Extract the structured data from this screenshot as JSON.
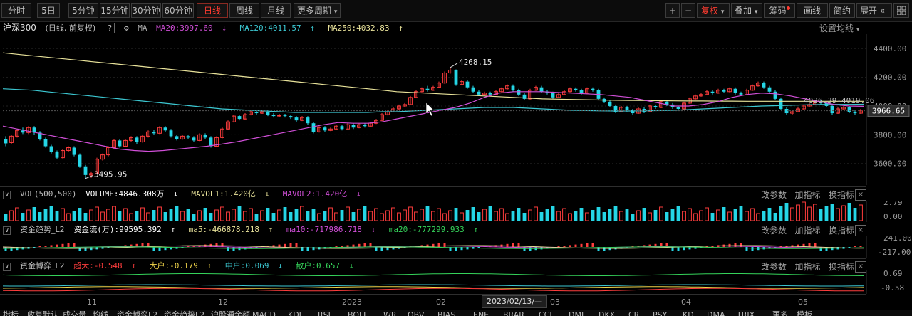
{
  "toolbar": {
    "periods": [
      "分时",
      "5日",
      "5分钟",
      "15分钟",
      "30分钟",
      "60分钟",
      "日线",
      "周线",
      "月线",
      "更多周期"
    ],
    "active_period": "日线",
    "more_arrow": "▾",
    "plus": "+",
    "minus": "−",
    "fuquan": "复权",
    "diejia": "叠加",
    "chouma": "筹码",
    "huaxian": "画线",
    "jianyue": "简约",
    "zhankai": "展开",
    "expand_icon": "«",
    "grid_icon": "grid-icon"
  },
  "main_info": {
    "name": "沪深300",
    "mode": "(日线, 前复权)",
    "help": "?",
    "ma_label": "MA",
    "ma20": "MA20:3997.60",
    "ma20_arrow": "↓",
    "ma120": "MA120:4011.57",
    "ma120_arrow": "↑",
    "ma250": "MA250:4032.83",
    "ma250_arrow": "↑",
    "setting": "设置均线",
    "setting_arrow": "▾",
    "colors": {
      "ma20": "#d14fd8",
      "ma120": "#3cc8d2",
      "ma250": "#e8e29a",
      "up": "#ff3d3d",
      "down": "#25d6e6"
    }
  },
  "vol_info": {
    "label": "VOL(500,500)",
    "volume": "VOLUME:4846.308万",
    "volume_arrow": "↓",
    "mavol1": "MAVOL1:1.420亿",
    "mavol1_arrow": "↓",
    "mavol2": "MAVOL2:1.420亿",
    "mavol2_arrow": "↓",
    "ctl": [
      "改参数",
      "加指标",
      "换指标"
    ],
    "close": "×"
  },
  "flow_info": {
    "label": "资金趋势_L2",
    "zjl": "资金流(万):99595.392",
    "zjl_arrow": "↑",
    "ma5": "ma5:-466878.218",
    "ma5_arrow": "↑",
    "ma10": "ma10:-717986.718",
    "ma10_arrow": "↓",
    "ma20": "ma20:-777299.933",
    "ma20_arrow": "↑",
    "ctl": [
      "改参数",
      "加指标",
      "换指标"
    ],
    "close": "×"
  },
  "game_info": {
    "label": "资金博弈_L2",
    "chaoda": "超大:-0.548",
    "chaoda_arrow": "↑",
    "dahu": "大户:-0.179",
    "dahu_arrow": "↑",
    "zhonghu": "中户:0.069",
    "zhonghu_arrow": "↓",
    "sanhu": "散户:0.657",
    "sanhu_arrow": "↓",
    "ctl": [
      "改参数",
      "加指标",
      "换指标"
    ],
    "close": "×"
  },
  "chart_data": [
    {
      "type": "candlestick",
      "title": "沪深300",
      "y_ticks": [
        "4400.00",
        "4200.00",
        "4000.00",
        "3800.00",
        "3600.00"
      ],
      "ylim": [
        3450,
        4500
      ],
      "current_price": "3966.65",
      "annotations": {
        "high": "4268.15",
        "low": "3495.95",
        "range": "4026.39-4019.06"
      },
      "x_ticks": [
        "11",
        "12",
        "2023",
        "02",
        "03",
        "04",
        "05"
      ],
      "cursor_date": "2023/02/13/—",
      "candles": [
        [
          3770,
          3740,
          3790,
          3720
        ],
        [
          3745,
          3790,
          3800,
          3735
        ],
        [
          3790,
          3830,
          3840,
          3780
        ],
        [
          3830,
          3815,
          3850,
          3805
        ],
        [
          3815,
          3850,
          3860,
          3805
        ],
        [
          3850,
          3815,
          3860,
          3800
        ],
        [
          3815,
          3770,
          3825,
          3760
        ],
        [
          3770,
          3720,
          3780,
          3710
        ],
        [
          3720,
          3680,
          3730,
          3670
        ],
        [
          3680,
          3640,
          3690,
          3630
        ],
        [
          3640,
          3690,
          3700,
          3635
        ],
        [
          3690,
          3710,
          3720,
          3680
        ],
        [
          3710,
          3660,
          3720,
          3650
        ],
        [
          3660,
          3580,
          3670,
          3570
        ],
        [
          3580,
          3520,
          3590,
          3496
        ],
        [
          3520,
          3530,
          3545,
          3500
        ],
        [
          3530,
          3630,
          3640,
          3525
        ],
        [
          3630,
          3660,
          3670,
          3620
        ],
        [
          3660,
          3710,
          3720,
          3650
        ],
        [
          3710,
          3760,
          3770,
          3700
        ],
        [
          3760,
          3720,
          3770,
          3710
        ],
        [
          3720,
          3760,
          3770,
          3715
        ],
        [
          3760,
          3780,
          3790,
          3750
        ],
        [
          3780,
          3750,
          3790,
          3735
        ],
        [
          3750,
          3790,
          3800,
          3745
        ],
        [
          3790,
          3820,
          3830,
          3780
        ],
        [
          3820,
          3810,
          3835,
          3800
        ],
        [
          3810,
          3850,
          3860,
          3805
        ],
        [
          3850,
          3830,
          3860,
          3820
        ],
        [
          3830,
          3790,
          3840,
          3780
        ],
        [
          3790,
          3770,
          3800,
          3760
        ],
        [
          3770,
          3790,
          3800,
          3765
        ],
        [
          3790,
          3780,
          3800,
          3770
        ],
        [
          3780,
          3760,
          3790,
          3750
        ],
        [
          3760,
          3800,
          3810,
          3755
        ],
        [
          3800,
          3780,
          3810,
          3770
        ],
        [
          3780,
          3720,
          3790,
          3710
        ],
        [
          3720,
          3780,
          3790,
          3715
        ],
        [
          3780,
          3840,
          3850,
          3775
        ],
        [
          3840,
          3890,
          3900,
          3835
        ],
        [
          3890,
          3930,
          3940,
          3885
        ],
        [
          3930,
          3910,
          3940,
          3900
        ],
        [
          3910,
          3940,
          3950,
          3905
        ],
        [
          3940,
          3960,
          3970,
          3935
        ],
        [
          3960,
          3950,
          3975,
          3940
        ],
        [
          3950,
          3960,
          3970,
          3945
        ],
        [
          3960,
          3940,
          3970,
          3930
        ],
        [
          3940,
          3930,
          3950,
          3920
        ],
        [
          3930,
          3935,
          3945,
          3925
        ],
        [
          3935,
          3930,
          3945,
          3920
        ],
        [
          3930,
          3920,
          3940,
          3910
        ],
        [
          3920,
          3900,
          3930,
          3890
        ],
        [
          3900,
          3920,
          3930,
          3895
        ],
        [
          3920,
          3880,
          3930,
          3870
        ],
        [
          3880,
          3820,
          3890,
          3810
        ],
        [
          3820,
          3850,
          3860,
          3815
        ],
        [
          3850,
          3830,
          3860,
          3820
        ],
        [
          3830,
          3840,
          3850,
          3825
        ],
        [
          3840,
          3860,
          3870,
          3835
        ],
        [
          3860,
          3840,
          3870,
          3830
        ],
        [
          3840,
          3870,
          3880,
          3835
        ],
        [
          3870,
          3850,
          3880,
          3840
        ],
        [
          3850,
          3870,
          3880,
          3845
        ],
        [
          3870,
          3860,
          3880,
          3850
        ],
        [
          3860,
          3880,
          3890,
          3855
        ],
        [
          3880,
          3900,
          3910,
          3875
        ],
        [
          3900,
          3940,
          3950,
          3895
        ],
        [
          3940,
          3960,
          3970,
          3935
        ],
        [
          3960,
          3980,
          3990,
          3955
        ],
        [
          3980,
          4000,
          4010,
          3975
        ],
        [
          4000,
          4010,
          4020,
          3995
        ],
        [
          4010,
          4060,
          4070,
          4005
        ],
        [
          4060,
          4100,
          4110,
          4055
        ],
        [
          4100,
          4120,
          4130,
          4095
        ],
        [
          4120,
          4110,
          4140,
          4100
        ],
        [
          4110,
          4130,
          4140,
          4105
        ],
        [
          4130,
          4160,
          4170,
          4125
        ],
        [
          4160,
          4230,
          4240,
          4155
        ],
        [
          4230,
          4250,
          4268,
          4225
        ],
        [
          4250,
          4150,
          4255,
          4140
        ],
        [
          4150,
          4170,
          4180,
          4145
        ],
        [
          4170,
          4130,
          4180,
          4120
        ],
        [
          4130,
          4100,
          4140,
          4090
        ],
        [
          4100,
          4080,
          4110,
          4070
        ],
        [
          4080,
          4090,
          4100,
          4070
        ],
        [
          4090,
          4080,
          4100,
          4075
        ],
        [
          4080,
          4100,
          4110,
          4075
        ],
        [
          4100,
          4120,
          4130,
          4095
        ],
        [
          4120,
          4140,
          4150,
          4115
        ],
        [
          4140,
          4110,
          4150,
          4100
        ],
        [
          4110,
          4080,
          4120,
          4070
        ],
        [
          4080,
          4050,
          4090,
          4040
        ],
        [
          4050,
          4110,
          4120,
          4045
        ],
        [
          4110,
          4130,
          4140,
          4105
        ],
        [
          4130,
          4100,
          4140,
          4090
        ],
        [
          4100,
          4090,
          4110,
          4080
        ],
        [
          4090,
          4060,
          4100,
          4050
        ],
        [
          4060,
          4080,
          4090,
          4055
        ],
        [
          4080,
          4100,
          4110,
          4075
        ],
        [
          4100,
          4120,
          4130,
          4095
        ],
        [
          4120,
          4110,
          4130,
          4100
        ],
        [
          4110,
          4090,
          4120,
          4080
        ],
        [
          4090,
          4120,
          4130,
          4085
        ],
        [
          4120,
          4110,
          4130,
          4100
        ],
        [
          4110,
          4050,
          4120,
          4040
        ],
        [
          4050,
          4030,
          4060,
          4020
        ],
        [
          4030,
          4000,
          4040,
          3990
        ],
        [
          4000,
          3960,
          4010,
          3950
        ],
        [
          3960,
          3990,
          4000,
          3955
        ],
        [
          3990,
          3970,
          4000,
          3960
        ],
        [
          3970,
          3950,
          3980,
          3940
        ],
        [
          3950,
          3980,
          3990,
          3945
        ],
        [
          3980,
          3960,
          3990,
          3950
        ],
        [
          3960,
          4000,
          4010,
          3955
        ],
        [
          4000,
          3990,
          4010,
          3980
        ],
        [
          3990,
          4030,
          4040,
          3985
        ],
        [
          4030,
          4010,
          4040,
          4000
        ],
        [
          4010,
          3990,
          4020,
          3980
        ],
        [
          3990,
          3980,
          4000,
          3970
        ],
        [
          3980,
          4020,
          4030,
          3975
        ],
        [
          4020,
          4050,
          4060,
          4015
        ],
        [
          4050,
          4070,
          4080,
          4045
        ],
        [
          4070,
          4080,
          4090,
          4065
        ],
        [
          4080,
          4100,
          4110,
          4075
        ],
        [
          4100,
          4090,
          4110,
          4080
        ],
        [
          4090,
          4110,
          4120,
          4085
        ],
        [
          4110,
          4100,
          4120,
          4090
        ],
        [
          4100,
          4120,
          4130,
          4095
        ],
        [
          4120,
          4090,
          4130,
          4080
        ],
        [
          4090,
          4080,
          4100,
          4070
        ],
        [
          4080,
          4110,
          4120,
          4075
        ],
        [
          4110,
          4140,
          4150,
          4105
        ],
        [
          4140,
          4160,
          4170,
          4135
        ],
        [
          4160,
          4130,
          4170,
          4120
        ],
        [
          4130,
          4100,
          4140,
          4090
        ],
        [
          4100,
          4050,
          4110,
          4040
        ],
        [
          4050,
          3980,
          4060,
          3970
        ],
        [
          3980,
          3950,
          3990,
          3940
        ],
        [
          3950,
          3960,
          3970,
          3940
        ],
        [
          3960,
          3980,
          3990,
          3955
        ],
        [
          3980,
          4000,
          4010,
          3975
        ],
        [
          4000,
          4010,
          4020,
          3995
        ],
        [
          4010,
          4030,
          4040,
          4005
        ],
        [
          4030,
          4020,
          4040,
          4010
        ],
        [
          4020,
          4000,
          4030,
          3990
        ],
        [
          4000,
          3950,
          4010,
          3940
        ],
        [
          3950,
          3980,
          3990,
          3945
        ],
        [
          3980,
          3990,
          4000,
          3970
        ],
        [
          3990,
          3960,
          4000,
          3950
        ],
        [
          3960,
          3950,
          3970,
          3940
        ],
        [
          3950,
          3966,
          3980,
          3945
        ]
      ],
      "ma20": [
        3860,
        3840,
        3820,
        3800,
        3780,
        3760,
        3740,
        3720,
        3700,
        3690,
        3685,
        3690,
        3700,
        3710,
        3720,
        3735,
        3750,
        3770,
        3790,
        3810,
        3830,
        3850,
        3870,
        3885,
        3880,
        3880,
        3890,
        3910,
        3930,
        3950,
        3970,
        3990,
        4020,
        4060,
        4090,
        4100,
        4100,
        4100,
        4095,
        4090,
        4085,
        4080,
        4070,
        4060,
        4040,
        4020,
        4000,
        4000,
        4010,
        4030,
        4060,
        4080,
        4090,
        4085,
        4070,
        4050,
        4030,
        4010,
        4000,
        3998
      ],
      "ma120": [
        4120,
        4115,
        4110,
        4100,
        4090,
        4080,
        4070,
        4060,
        4050,
        4040,
        4030,
        4020,
        4010,
        4000,
        3990,
        3980,
        3975,
        3970,
        3965,
        3960,
        3955,
        3955,
        3955,
        3955,
        3955,
        3955,
        3960,
        3960,
        3965,
        3970,
        3975,
        3980,
        3985,
        3990,
        3990,
        3990,
        3985,
        3980,
        3975,
        3970,
        3968,
        3966,
        3965,
        3965,
        3966,
        3968,
        3970,
        3975,
        3980,
        3985,
        3990,
        3995,
        4000,
        4002,
        4005,
        4008,
        4010,
        4011,
        4011,
        4012
      ],
      "ma250": [
        4370,
        4360,
        4350,
        4340,
        4330,
        4320,
        4310,
        4300,
        4290,
        4280,
        4270,
        4260,
        4250,
        4240,
        4230,
        4220,
        4210,
        4200,
        4190,
        4180,
        4170,
        4160,
        4150,
        4140,
        4130,
        4120,
        4110,
        4100,
        4095,
        4090,
        4085,
        4080,
        4075,
        4070,
        4065,
        4060,
        4055,
        4050,
        4048,
        4046,
        4044,
        4042,
        4040,
        4039,
        4038,
        4037,
        4036,
        4035,
        4035,
        4034,
        4034,
        4033,
        4033,
        4033,
        4033,
        4033,
        4033,
        4033,
        4033,
        4033
      ]
    },
    {
      "type": "bar",
      "title": "VOL(500,500)",
      "y_ticks": [
        "2.79",
        "0.00"
      ],
      "ylim": [
        0,
        3.0
      ]
    },
    {
      "type": "bar",
      "title": "资金趋势_L2",
      "y_ticks": [
        "241.00",
        "-217.00"
      ],
      "ylim": [
        -260,
        260
      ]
    },
    {
      "type": "line",
      "title": "资金博弈_L2",
      "y_ticks": [
        "0.69",
        "-0.58"
      ],
      "ylim": [
        -0.7,
        0.8
      ]
    }
  ],
  "bottom_tabs": [
    "指标",
    "收复默认",
    "成交量",
    "均线",
    "资金博弈L2",
    "资金趋势L2",
    "沪股通余额",
    "MACD",
    "KDJ",
    "RSI",
    "BOLL",
    "WR",
    "OBV",
    "BIAS",
    "ENE",
    "BRAR",
    "CCI",
    "DMI",
    "DKX",
    "CR",
    "PSY",
    "KD",
    "DMA",
    "TRIX",
    "更多",
    "模板"
  ]
}
